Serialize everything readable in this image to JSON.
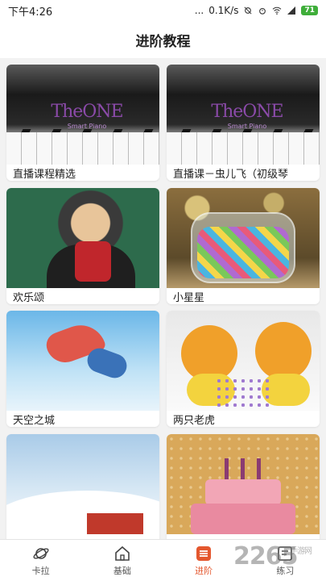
{
  "status_bar": {
    "time": "下午4:26",
    "more": "...",
    "network_speed": "0.1K/s",
    "battery": "71"
  },
  "header": {
    "title": "进阶教程"
  },
  "courses": [
    {
      "title": "直播课程精选",
      "logo_text": "TheONE",
      "logo_sub": "Smart Piano"
    },
    {
      "title": "直播课－虫儿飞（初级琴",
      "logo_text": "TheONE",
      "logo_sub": "Smart Piano"
    },
    {
      "title": "欢乐颂"
    },
    {
      "title": "小星星"
    },
    {
      "title": "天空之城"
    },
    {
      "title": "两只老虎"
    },
    {
      "title": ""
    },
    {
      "title": ""
    }
  ],
  "tabs": [
    {
      "label": "卡拉",
      "icon": "planet-icon"
    },
    {
      "label": "基础",
      "icon": "home-icon"
    },
    {
      "label": "进阶",
      "icon": "list-icon",
      "active": true
    },
    {
      "label": "练习",
      "icon": "practice-icon"
    }
  ],
  "watermark": {
    "text": "2265",
    "sub": "手游网"
  },
  "colors": {
    "accent": "#e4572e",
    "battery": "#3fae3a"
  }
}
